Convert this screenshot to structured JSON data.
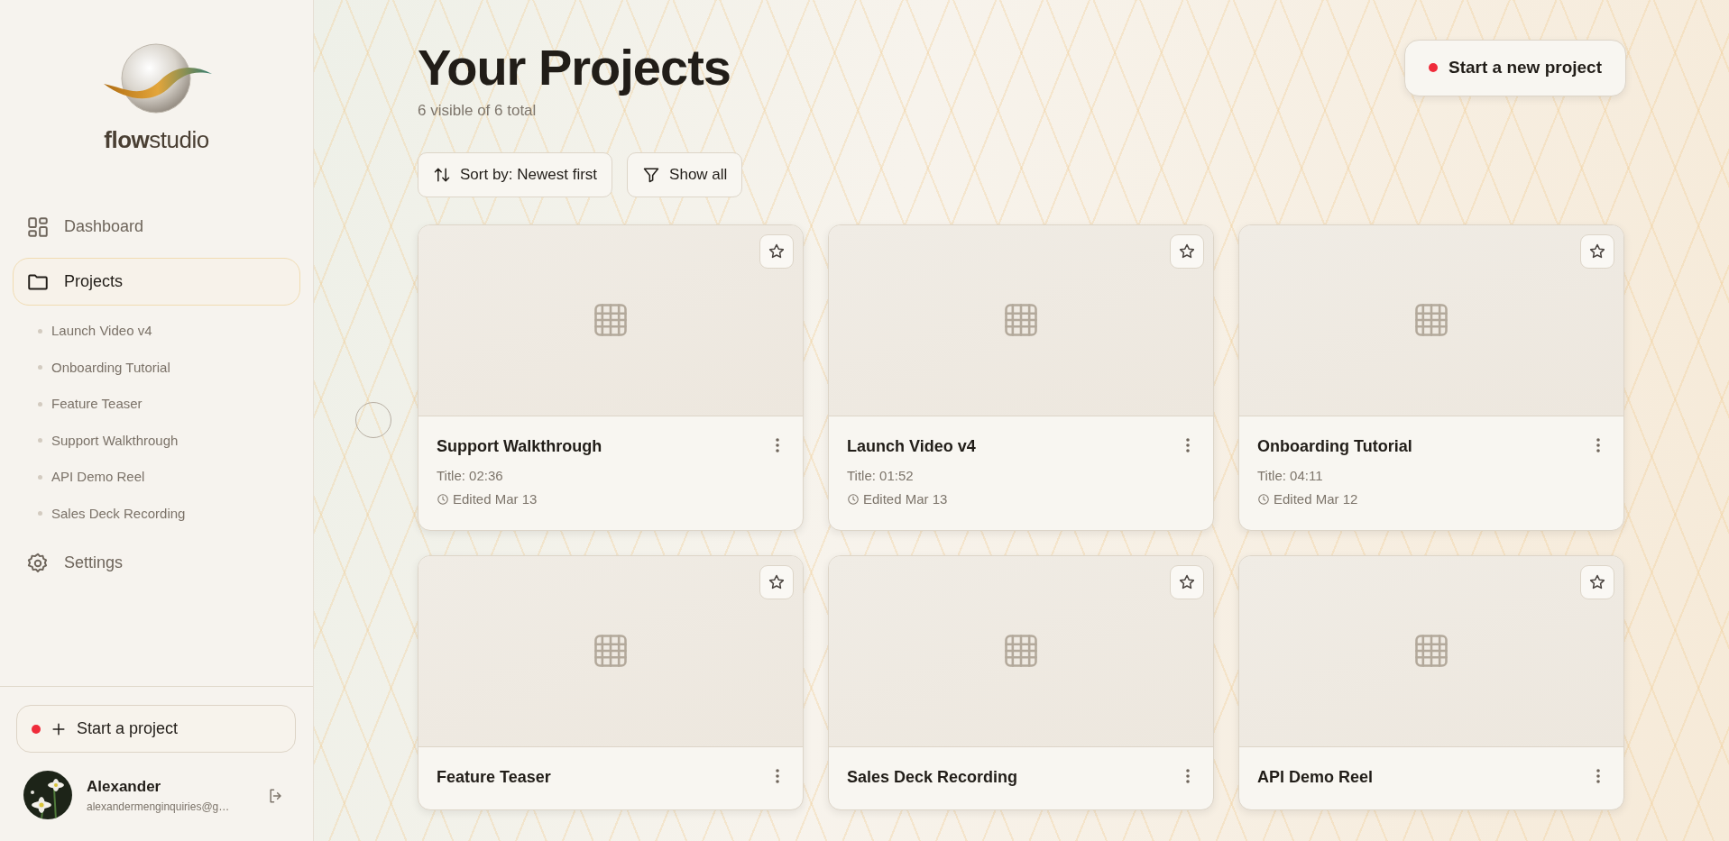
{
  "brand": {
    "name_bold": "flow",
    "name_light": "studio"
  },
  "nav": [
    {
      "label": "Dashboard",
      "selected": false
    },
    {
      "label": "Projects",
      "selected": true,
      "children": [
        {
          "label": "Launch Video v4"
        },
        {
          "label": "Onboarding Tutorial"
        },
        {
          "label": "Feature Teaser"
        },
        {
          "label": "Support Walkthrough"
        },
        {
          "label": "API Demo Reel"
        },
        {
          "label": "Sales Deck Recording"
        }
      ]
    },
    {
      "label": "Settings",
      "selected": false
    }
  ],
  "sidebar_button": {
    "label": "Start a project"
  },
  "user": {
    "name": "Alexander",
    "email": "alexandermenginquiries@g…"
  },
  "header": {
    "title": "Your Projects",
    "subtitle": "6 visible of 6 total",
    "new_button": "Start a new project"
  },
  "filters": [
    {
      "label": "Sort by: Newest first"
    },
    {
      "label": "Show all"
    }
  ],
  "projects": [
    {
      "title": "Support Walkthrough",
      "duration": "Title: 02:36",
      "edited": "Edited Mar 13",
      "starred": false
    },
    {
      "title": "Launch Video v4",
      "duration": "Title: 01:52",
      "edited": "Edited Mar 13",
      "starred": false
    },
    {
      "title": "Onboarding Tutorial",
      "duration": "Title: 04:11",
      "edited": "Edited Mar 12",
      "starred": false
    },
    {
      "title": "Feature Teaser",
      "starred": false
    },
    {
      "title": "Sales Deck Recording",
      "starred": false
    },
    {
      "title": "API Demo Reel",
      "starred": false
    }
  ]
}
